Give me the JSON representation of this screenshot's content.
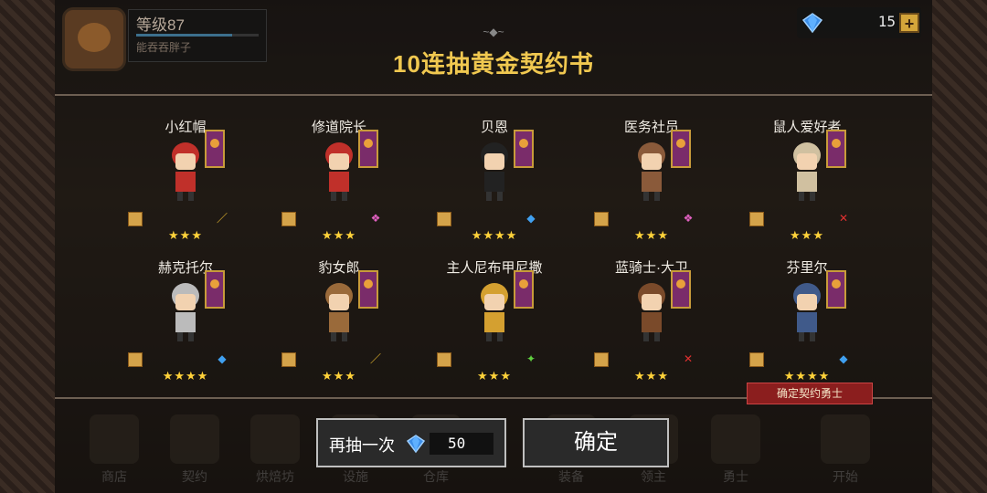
{
  "profile": {
    "level": "等级87",
    "nickname": "能吞吞胖子"
  },
  "title": "10连抽黄金契约书",
  "gems": {
    "count": "15",
    "plus": "+"
  },
  "heroes": [
    {
      "name": "小红帽",
      "stars": "★★★",
      "weapon": "sword"
    },
    {
      "name": "修道院长",
      "stars": "★★★",
      "weapon": "staff"
    },
    {
      "name": "贝恩",
      "stars": "★★★★",
      "weapon": "axe"
    },
    {
      "name": "医务社员",
      "stars": "★★★",
      "weapon": "staff"
    },
    {
      "name": "鼠人爱好者",
      "stars": "★★★",
      "weapon": "cross"
    },
    {
      "name": "赫克托尔",
      "stars": "★★★★",
      "weapon": "axe"
    },
    {
      "name": "豹女郎",
      "stars": "★★★",
      "weapon": "sword"
    },
    {
      "name": "主人尼布甲尼撒",
      "stars": "★★★",
      "weapon": "shuriken"
    },
    {
      "name": "蓝骑士·大卫",
      "stars": "★★★",
      "weapon": "cross"
    },
    {
      "name": "芬里尔",
      "stars": "★★★★",
      "weapon": "axe"
    }
  ],
  "confirm_hero_label": "确定契约勇士",
  "nav": [
    "商店",
    "契约",
    "烘焙坊",
    "设施",
    "仓库",
    "装备",
    "领主",
    "勇士",
    "开始"
  ],
  "buttons": {
    "again_label": "再抽一次",
    "again_cost": "50",
    "ok_label": "确定"
  }
}
